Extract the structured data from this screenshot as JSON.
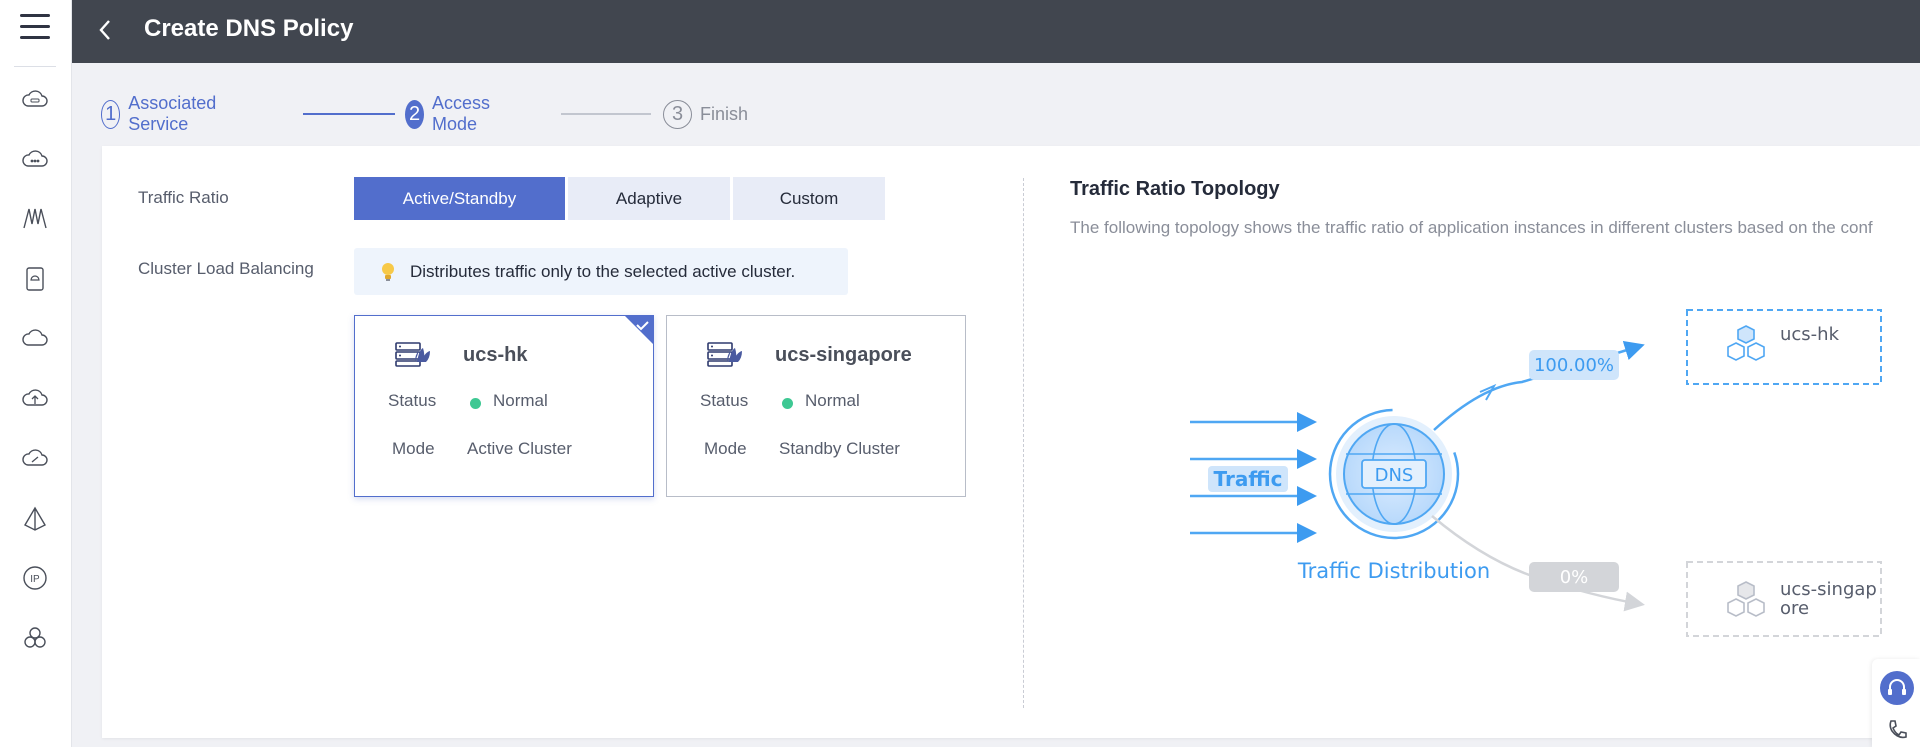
{
  "header": {
    "title": "Create DNS Policy"
  },
  "sidebar": {
    "icons": [
      "cloud-cce-icon",
      "cloud-ucs-icon",
      "network-icon",
      "container-icon",
      "cloud-icon",
      "cloud-upload-icon",
      "cloud-sync-icon",
      "pyramid-icon",
      "ip-icon",
      "hexagon-cluster-icon"
    ]
  },
  "steps": [
    {
      "num": "1",
      "label": "Associated Service",
      "state": "done"
    },
    {
      "num": "2",
      "label": "Access Mode",
      "state": "current"
    },
    {
      "num": "3",
      "label": "Finish",
      "state": "todo"
    }
  ],
  "form": {
    "traffic_ratio_label": "Traffic Ratio",
    "traffic_options": [
      "Active/Standby",
      "Adaptive",
      "Custom"
    ],
    "selected_option": "Active/Standby",
    "cluster_lb_label": "Cluster Load Balancing",
    "tip": "Distributes traffic only to the selected active cluster.",
    "clusters": [
      {
        "name": "ucs-hk",
        "status_label": "Status",
        "status": "Normal",
        "mode_label": "Mode",
        "mode": "Active Cluster",
        "selected": true
      },
      {
        "name": "ucs-singapore",
        "status_label": "Status",
        "status": "Normal",
        "mode_label": "Mode",
        "mode": "Standby Cluster",
        "selected": false
      }
    ]
  },
  "topology": {
    "title": "Traffic Ratio Topology",
    "description": "The following topology shows the traffic ratio of application instances in different clusters based on the conf",
    "traffic_label": "Traffic",
    "dns_label": "DNS",
    "distribution_label": "Traffic Distribution",
    "targets": [
      {
        "name": "ucs-hk",
        "ratio": "100.00%",
        "active": true
      },
      {
        "name_line1": "ucs-singap",
        "name_line2": "ore",
        "ratio": "0%",
        "active": false
      }
    ]
  },
  "colors": {
    "primary": "#526ecc",
    "header_bg": "#41464f",
    "status_normal": "#3ec893",
    "topo_blue": "#3d9bf0"
  }
}
